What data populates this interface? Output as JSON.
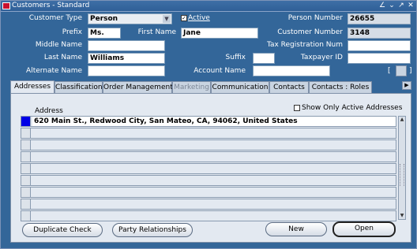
{
  "window": {
    "title": "Customers - Standard",
    "controls": {
      "minimize": "⌄",
      "maximize": "↗",
      "close": "✕",
      "extra": "∠"
    }
  },
  "form": {
    "customer_type": {
      "label": "Customer Type",
      "value": "Person"
    },
    "active": {
      "label": "Active",
      "checked": true
    },
    "person_number": {
      "label": "Person Number",
      "value": "26655"
    },
    "prefix": {
      "label": "Prefix",
      "value": "Ms."
    },
    "first_name": {
      "label": "First Name",
      "value": "Jane"
    },
    "customer_number": {
      "label": "Customer Number",
      "value": "3148"
    },
    "middle_name": {
      "label": "Middle Name",
      "value": ""
    },
    "tax_registration_num": {
      "label": "Tax Registration Num",
      "value": ""
    },
    "last_name": {
      "label": "Last Name",
      "value": "Williams"
    },
    "suffix": {
      "label": "Suffix",
      "value": ""
    },
    "taxpayer_id": {
      "label": "Taxpayer ID",
      "value": ""
    },
    "alternate_name": {
      "label": "Alternate Name",
      "value": ""
    },
    "account_name": {
      "label": "Account Name",
      "value": ""
    }
  },
  "tabs": [
    {
      "label": "Addresses",
      "active": true
    },
    {
      "label": "Classification"
    },
    {
      "label": "Order Management"
    },
    {
      "label": "Marketing",
      "disabled": true
    },
    {
      "label": "Communication"
    },
    {
      "label": "Contacts"
    },
    {
      "label": "Contacts : Roles"
    }
  ],
  "addresses": {
    "column_header": "Address",
    "show_only_active_label": "Show Only Active Addresses",
    "rows": [
      "620 Main St., Redwood City, San Mateo, CA, 94062, United States",
      "",
      "",
      "",
      "",
      "",
      "",
      "",
      ""
    ]
  },
  "buttons": {
    "duplicate_check": "Duplicate Check",
    "party_relationships": "Party Relationships",
    "new": "New",
    "open": "Open"
  },
  "colors": {
    "window_bg": "#336699",
    "panel_bg": "#e3e9f1",
    "selected_row_marker": "#0000e6"
  }
}
